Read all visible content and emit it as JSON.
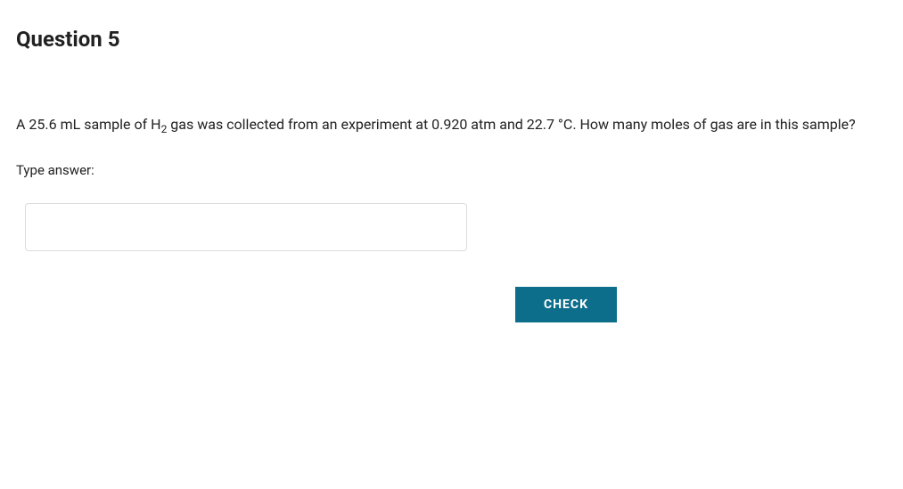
{
  "question": {
    "title": "Question 5",
    "body_parts": {
      "pre": "A 25.6 mL sample of H",
      "sub": "2",
      "post": " gas was collected from an experiment at 0.920 atm and 22.7  °C. How many moles of gas are in this sample?"
    },
    "answer_label": "Type answer:",
    "answer_value": ""
  },
  "buttons": {
    "check": "CHECK"
  }
}
